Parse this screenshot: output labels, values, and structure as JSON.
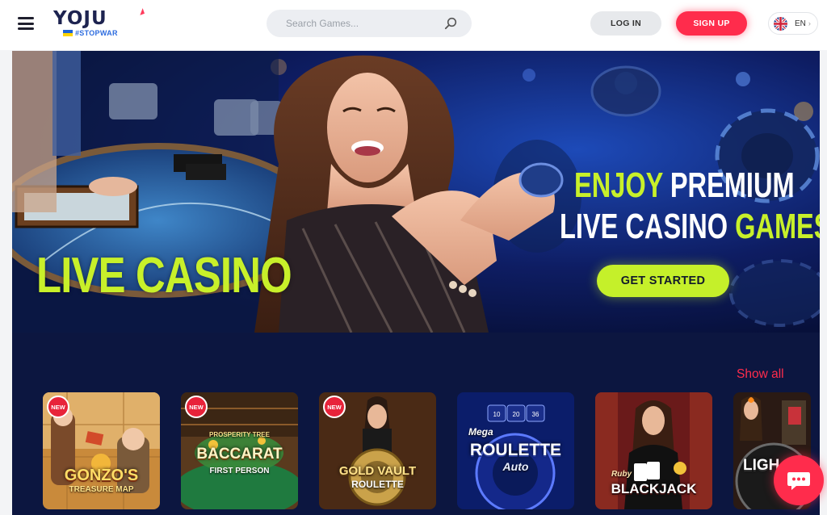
{
  "header": {
    "logo_text": "YOJU",
    "logo_tagline": "#STOPWAR",
    "search_placeholder": "Search Games...",
    "login_label": "LOG IN",
    "signup_label": "SIGN UP",
    "language": "EN"
  },
  "banner": {
    "left_title": "LIVE CASINO",
    "promo_line1_a": "ENJOY",
    "promo_line1_b": " PREMIUM",
    "promo_line2_a": "LIVE CASINO ",
    "promo_line2_b": "GAMES",
    "cta_label": "GET STARTED"
  },
  "games": {
    "show_all_label": "Show all",
    "items": [
      {
        "title": "GONZO'S",
        "subtitle": "TREASURE MAP",
        "badge": "NEW"
      },
      {
        "title": "BACCARAT",
        "subtitle": "FIRST PERSON",
        "badge": "NEW",
        "top": "PROSPERITY TREE"
      },
      {
        "title": "GOLD VAULT",
        "subtitle": "ROULETTE",
        "badge": "NEW"
      },
      {
        "title": "ROULETTE",
        "subtitle": "Auto",
        "top": "Mega"
      },
      {
        "title": "BLACKJACK",
        "top": "Ruby"
      },
      {
        "title": "LIGH"
      }
    ]
  },
  "colors": {
    "accent": "#ff2c4c",
    "lime": "#c8f02a",
    "navy": "#0c1640"
  }
}
